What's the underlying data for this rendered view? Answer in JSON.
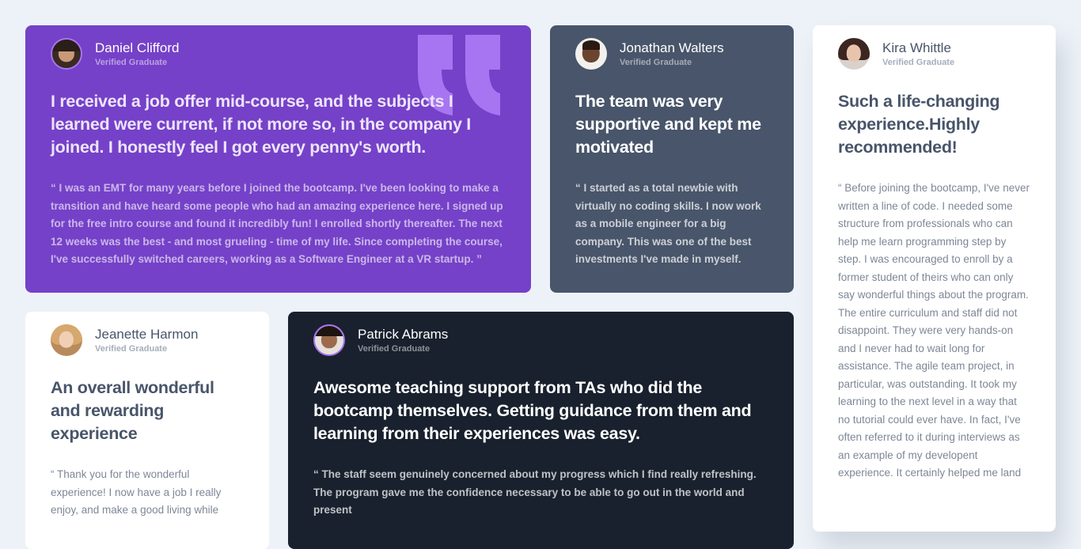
{
  "testimonials": [
    {
      "name": "Daniel Clifford",
      "role": "Verified Graduate",
      "title": "I received a job offer mid-course, and the subjects I learned were current, if not more so, in the company I joined. I honestly feel I got every penny's worth.",
      "body": "“ I was an EMT for many years before I joined the bootcamp. I've been looking to make a transition and have heard some people who had an amazing experience here. I signed up for the free intro course and found it incredibly fun! I enrolled shortly thereafter. The next 12 weeks was the best - and most grueling - time of my life. Since completing the course, I've successfully switched careers, working as a Software Engineer at a VR startup. ”",
      "background": "#7541c8"
    },
    {
      "name": "Jonathan Walters",
      "role": "Verified Graduate",
      "title": "The team was very supportive and kept me motivated",
      "body": "“ I started as a total newbie with virtually no coding skills. I now work as a mobile engineer for a big company. This was one of the best investments I've made in myself.",
      "background": "#48556a"
    },
    {
      "name": "Kira Whittle",
      "role": "Verified Graduate",
      "title": "Such a life-changing experience.Highly recommended!",
      "body": "“ Before joining the bootcamp, I've never written a line of code. I needed some structure from professionals who can help me learn programming step by step. I was encouraged to enroll by a former student of theirs who can only say wonderful things about the program. The entire curriculum and staff did not disappoint. They were very hands-on and I never had to wait long for assistance. The agile team project, in particular, was outstanding. It took my learning to the next level in a way that no tutorial could ever have. In fact, I've often referred to it during interviews as an example of my developent experience. It certainly helped me land",
      "background": "#ffffff"
    },
    {
      "name": "Jeanette Harmon",
      "role": "Verified Graduate",
      "title": "An overall wonderful and rewarding experience",
      "body": "“ Thank you for the wonderful experience! I now have a job I really enjoy, and make a good living while",
      "background": "#ffffff"
    },
    {
      "name": "Patrick Abrams",
      "role": "Verified Graduate",
      "title": "Awesome teaching support from TAs who did the bootcamp themselves. Getting guidance from them and learning from their experiences was easy.",
      "body": "“ The staff seem genuinely concerned about my progress which I find really refreshing. The program gave me the confidence necessary to be able to go out in the world and present",
      "background": "#19212e"
    }
  ],
  "colors": {
    "page_background": "#edf2f8",
    "moderate_violet": "#7541c8",
    "grayish_blue": "#48556a",
    "very_dark_blackish_blue": "#19212e",
    "light_violet_accent": "#a775f1"
  },
  "icons": {
    "quotation_mark": "quotation-icon",
    "avatars": [
      "avatar-daniel",
      "avatar-jonathan",
      "avatar-kira",
      "avatar-jeanette",
      "avatar-patrick"
    ]
  }
}
